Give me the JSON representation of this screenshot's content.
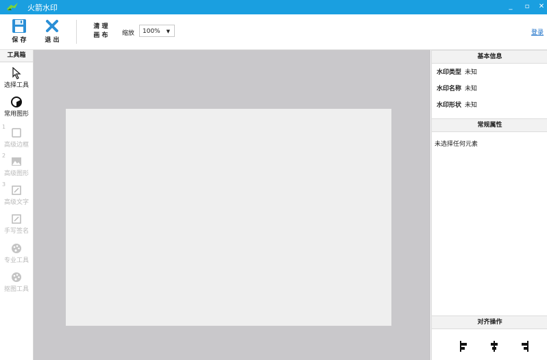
{
  "window": {
    "title": "火箭水印"
  },
  "toolbar": {
    "save_label": "保 存",
    "exit_label": "退 出",
    "clear_label_1": "清 理",
    "clear_label_2": "画 布",
    "zoom_label": "缩放",
    "zoom_value": "100%",
    "login_label": "登录"
  },
  "toolbox": {
    "header": "工具箱",
    "items": [
      {
        "label": "选择工具",
        "icon": "cursor-icon",
        "enabled": true
      },
      {
        "label": "常用图形",
        "icon": "shape-icon",
        "enabled": true
      },
      {
        "label": "高级边框",
        "icon": "border-icon",
        "enabled": false,
        "number": "1"
      },
      {
        "label": "高级图形",
        "icon": "image-icon",
        "enabled": false,
        "number": "2"
      },
      {
        "label": "高级文字",
        "icon": "text-icon",
        "enabled": false,
        "number": "3"
      },
      {
        "label": "手写签名",
        "icon": "signature-icon",
        "enabled": false
      },
      {
        "label": "专业工具",
        "icon": "palette-icon",
        "enabled": false
      },
      {
        "label": "抠图工具",
        "icon": "palette-icon",
        "enabled": false
      }
    ]
  },
  "right_panel": {
    "basic_info_header": "基本信息",
    "basic_info": [
      {
        "key": "水印类型",
        "value": "未知"
      },
      {
        "key": "水印名称",
        "value": "未知"
      },
      {
        "key": "水印形状",
        "value": "未知"
      }
    ],
    "general_props_header": "常规属性",
    "no_selection_text": "未选择任何元素",
    "align_header": "对齐操作"
  },
  "colors": {
    "titlebar": "#1a9fe0",
    "workspace": "#c9c8cb",
    "canvas": "#efefef",
    "link": "#1a6fc8"
  }
}
